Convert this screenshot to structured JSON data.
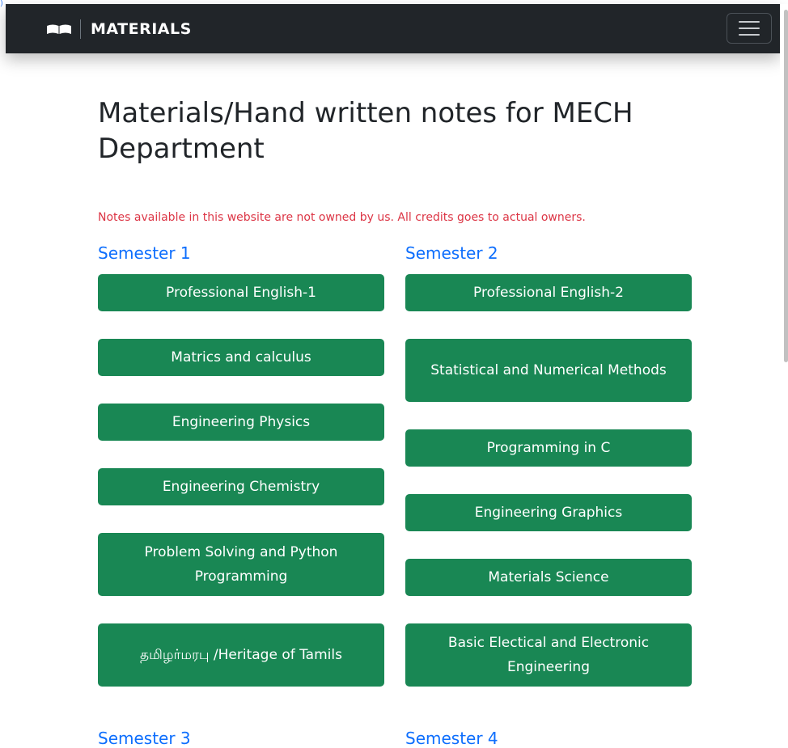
{
  "brand": {
    "text": "MATERIALS"
  },
  "page": {
    "title": "Materials/Hand written notes for MECH Department",
    "disclaimer": "Notes available in this website are not owned by us. All credits goes to actual owners."
  },
  "semesters": [
    {
      "title": "Semester 1",
      "subjects": [
        "Professional English-1",
        "Matrics and calculus",
        "Engineering Physics",
        "Engineering Chemistry",
        "Problem Solving and Python Programming",
        "தமிழர்மரபு /Heritage of Tamils"
      ]
    },
    {
      "title": "Semester 2",
      "subjects": [
        "Professional English-2",
        "Statistical and Numerical Methods",
        "Programming in C",
        "Engineering Graphics",
        "Materials Science",
        "Basic Electical and Electronic Engineering"
      ]
    },
    {
      "title": "Semester 3"
    },
    {
      "title": "Semester 4"
    }
  ],
  "colors": {
    "navbar": "#212529",
    "button": "#198754",
    "semester_heading": "#0d6efd",
    "disclaimer": "#dc3545"
  },
  "icons": {
    "brand": "open-book-icon",
    "menu": "hamburger-menu-icon"
  }
}
